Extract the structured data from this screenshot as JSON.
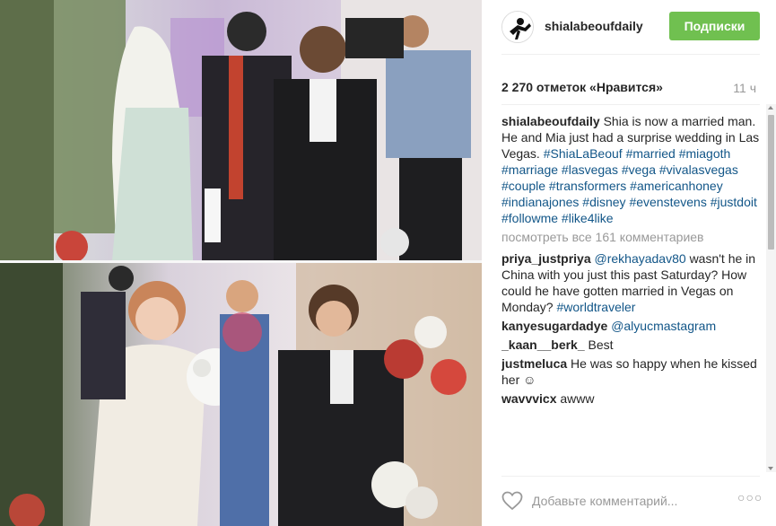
{
  "post": {
    "username": "shialabeoufdaily",
    "follow_label": "Подписки",
    "likes_text": "2 270 отметок «Нравится»",
    "time_ago": "11 ч",
    "caption": {
      "author": "shialabeoufdaily",
      "text": "Shia is now a married man. He and Mia just had a surprise wedding in Las Vegas.",
      "tags": "#ShiaLaBeouf #married #miagoth #marriage #lasvegas #vega #vivalasvegas #couple #transformers #americanhoney #indianajones #disney #evenstevens #justdoit #followme #like4like"
    },
    "view_all_label": "посмотреть все 161 комментариев",
    "comments": [
      {
        "author": "priya_justpriya",
        "mention": "@rekhayadav80",
        "text": "wasn't he in China with you just this past Saturday? How could he have gotten married in Vegas on Monday?",
        "tag": "#worldtraveler"
      },
      {
        "author": "kanyesugardadye",
        "mention": "@alyucmastagram",
        "text": "",
        "tag": ""
      },
      {
        "author": "_kaan__berk_",
        "mention": "",
        "text": "Best",
        "tag": ""
      },
      {
        "author": "justmeluca",
        "mention": "",
        "text": "He was so happy when he kissed her ☺",
        "tag": ""
      },
      {
        "author": "wavvvicx",
        "mention": "",
        "text": "awww",
        "tag": ""
      }
    ],
    "add_comment_placeholder": "Добавьте комментарий...",
    "more_label": "○○○"
  },
  "colors": {
    "follow_button": "#70c050",
    "link": "#125688",
    "muted": "#999999"
  }
}
